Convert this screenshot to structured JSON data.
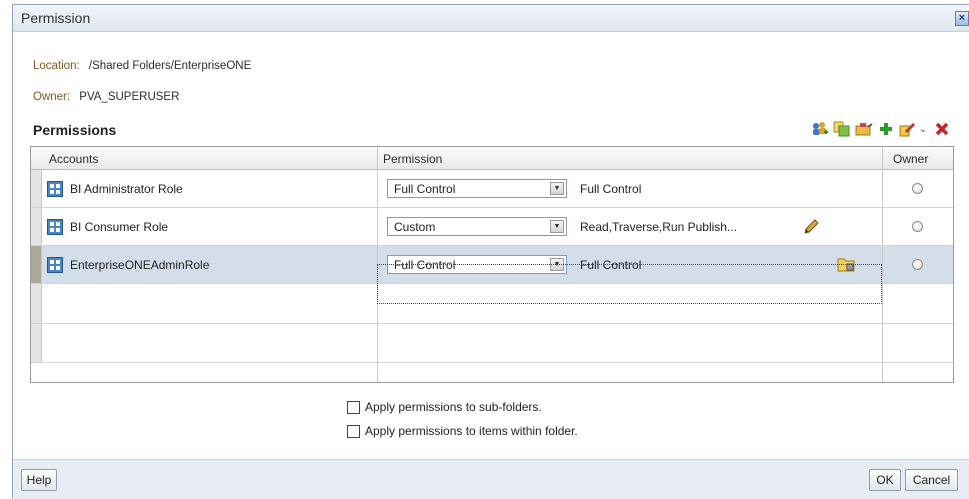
{
  "dialog": {
    "title": "Permission",
    "close_icon": "close-icon"
  },
  "location": {
    "label": "Location:",
    "value": "/Shared Folders/EnterpriseONE"
  },
  "owner": {
    "label": "Owner:",
    "value": "PVA_SUPERUSER"
  },
  "section": {
    "title": "Permissions"
  },
  "toolbar": {
    "icons": [
      "add-roles-icon",
      "copy-permissions-icon",
      "paste-permissions-icon",
      "add-icon",
      "edit-icon",
      "delete-icon"
    ]
  },
  "table": {
    "headers": {
      "accounts": "Accounts",
      "permission": "Permission",
      "owner": "Owner"
    },
    "rows": [
      {
        "account": "BI Administrator Role",
        "permission": "Full Control",
        "description": "Full Control",
        "selected": false
      },
      {
        "account": "BI Consumer Role",
        "permission": "Custom",
        "description": "Read,Traverse,Run Publish...",
        "selected": false
      },
      {
        "account": "EnterpriseONEAdminRole",
        "permission": "Full Control",
        "description": "Full Control",
        "selected": true
      }
    ]
  },
  "options": {
    "apply_subfolders": "Apply permissions to sub-folders.",
    "apply_items": "Apply permissions to items within folder."
  },
  "buttons": {
    "help": "Help",
    "ok": "OK",
    "cancel": "Cancel"
  },
  "colors": {
    "selected_row": "#d4deeb",
    "footer": "#e8edf3",
    "delete_red": "#cc2222",
    "add_green": "#2e9a2e"
  }
}
